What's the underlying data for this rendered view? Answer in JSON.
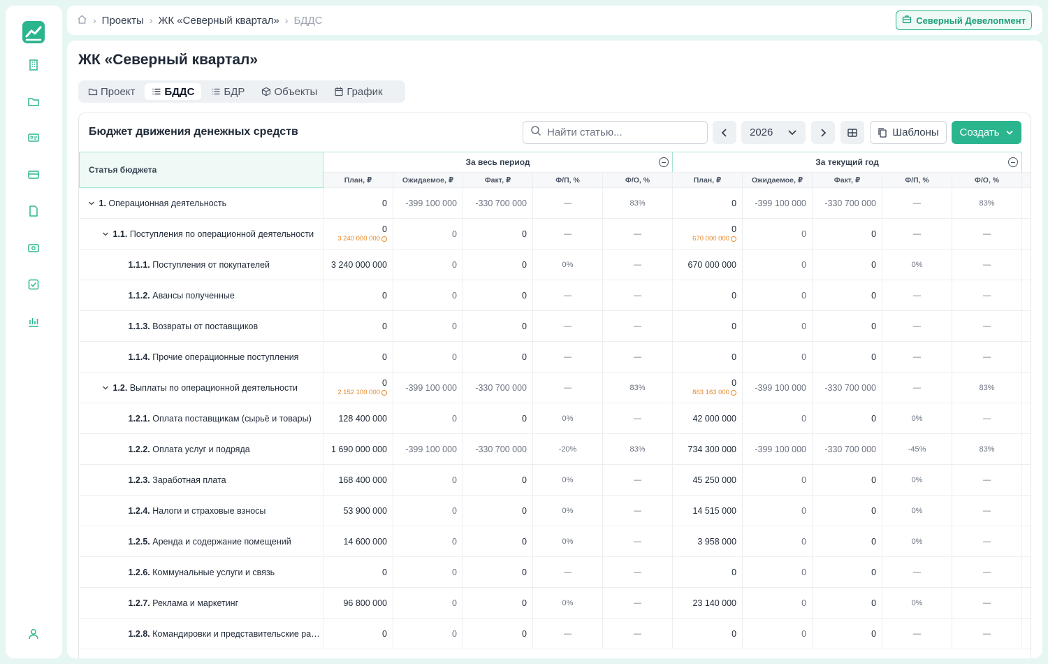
{
  "header": {
    "breadcrumbs": [
      "Проекты",
      "ЖК «Северный квартал»",
      "БДДС"
    ],
    "organization": "Северный Девелопмент"
  },
  "page": {
    "title": "ЖК «Северный квартал»",
    "tabs": [
      {
        "label": "Проект",
        "icon": "folder-icon"
      },
      {
        "label": "БДДС",
        "icon": "list-icon",
        "active": true
      },
      {
        "label": "БДР",
        "icon": "list-icon"
      },
      {
        "label": "Объекты",
        "icon": "cube-icon"
      },
      {
        "label": "График",
        "icon": "calendar-icon"
      }
    ]
  },
  "card": {
    "title": "Бюджет движения денежных средств",
    "search_placeholder": "Найти статью...",
    "year": "2026",
    "templates_label": "Шаблоны",
    "create_label": "Создать"
  },
  "table": {
    "article_header": "Статья бюджета",
    "groups": [
      "За весь период",
      "За текущий год"
    ],
    "subheaders": [
      "План, ₽",
      "Ожидаемое, ₽",
      "Факт, ₽",
      "Ф/П, %",
      "Ф/О, %"
    ],
    "rows": [
      {
        "level": 0,
        "code": "1.",
        "name": "Операционная деятельность",
        "expandable": true,
        "cells": [
          {
            "v": "0"
          },
          {
            "v": "-399 100 000",
            "m": true
          },
          {
            "v": "-330 700 000",
            "m": true
          },
          {
            "v": "—"
          },
          {
            "v": "83%"
          },
          {
            "v": "0"
          },
          {
            "v": "-399 100 000",
            "m": true
          },
          {
            "v": "-330 700 000",
            "m": true
          },
          {
            "v": "—"
          },
          {
            "v": "83%"
          }
        ]
      },
      {
        "level": 1,
        "code": "1.1.",
        "name": "Поступления по операционной деятельности",
        "expandable": true,
        "cells": [
          {
            "v": "0",
            "w": "3 240 000 000"
          },
          {
            "v": "0",
            "m": true
          },
          {
            "v": "0"
          },
          {
            "v": "—"
          },
          {
            "v": "—"
          },
          {
            "v": "0",
            "w": "670 000 000"
          },
          {
            "v": "0",
            "m": true
          },
          {
            "v": "0"
          },
          {
            "v": "—"
          },
          {
            "v": "—"
          }
        ]
      },
      {
        "level": 2,
        "code": "1.1.1.",
        "name": "Поступления от покупателей",
        "cells": [
          {
            "v": "3 240 000 000"
          },
          {
            "v": "0",
            "m": true
          },
          {
            "v": "0"
          },
          {
            "v": "0%"
          },
          {
            "v": "—"
          },
          {
            "v": "670 000 000"
          },
          {
            "v": "0",
            "m": true
          },
          {
            "v": "0"
          },
          {
            "v": "0%"
          },
          {
            "v": "—"
          }
        ]
      },
      {
        "level": 2,
        "code": "1.1.2.",
        "name": "Авансы полученные",
        "cells": [
          {
            "v": "0"
          },
          {
            "v": "0",
            "m": true
          },
          {
            "v": "0"
          },
          {
            "v": "—"
          },
          {
            "v": "—"
          },
          {
            "v": "0"
          },
          {
            "v": "0",
            "m": true
          },
          {
            "v": "0"
          },
          {
            "v": "—"
          },
          {
            "v": "—"
          }
        ]
      },
      {
        "level": 2,
        "code": "1.1.3.",
        "name": "Возвраты от поставщиков",
        "cells": [
          {
            "v": "0"
          },
          {
            "v": "0",
            "m": true
          },
          {
            "v": "0"
          },
          {
            "v": "—"
          },
          {
            "v": "—"
          },
          {
            "v": "0"
          },
          {
            "v": "0",
            "m": true
          },
          {
            "v": "0"
          },
          {
            "v": "—"
          },
          {
            "v": "—"
          }
        ]
      },
      {
        "level": 2,
        "code": "1.1.4.",
        "name": "Прочие операционные поступления",
        "cells": [
          {
            "v": "0"
          },
          {
            "v": "0",
            "m": true
          },
          {
            "v": "0"
          },
          {
            "v": "—"
          },
          {
            "v": "—"
          },
          {
            "v": "0"
          },
          {
            "v": "0",
            "m": true
          },
          {
            "v": "0"
          },
          {
            "v": "—"
          },
          {
            "v": "—"
          }
        ]
      },
      {
        "level": 1,
        "code": "1.2.",
        "name": "Выплаты по операционной деятельности",
        "expandable": true,
        "cells": [
          {
            "v": "0",
            "w": "2 152 100 000"
          },
          {
            "v": "-399 100 000",
            "m": true
          },
          {
            "v": "-330 700 000",
            "m": true
          },
          {
            "v": "—"
          },
          {
            "v": "83%"
          },
          {
            "v": "0",
            "w": "863 163 000"
          },
          {
            "v": "-399 100 000",
            "m": true
          },
          {
            "v": "-330 700 000",
            "m": true
          },
          {
            "v": "—"
          },
          {
            "v": "83%"
          }
        ]
      },
      {
        "level": 2,
        "code": "1.2.1.",
        "name": "Оплата поставщикам (сырьё и товары)",
        "cells": [
          {
            "v": "128 400 000"
          },
          {
            "v": "0",
            "m": true
          },
          {
            "v": "0"
          },
          {
            "v": "0%"
          },
          {
            "v": "—"
          },
          {
            "v": "42 000 000"
          },
          {
            "v": "0",
            "m": true
          },
          {
            "v": "0"
          },
          {
            "v": "0%"
          },
          {
            "v": "—"
          }
        ]
      },
      {
        "level": 2,
        "code": "1.2.2.",
        "name": "Оплата услуг и подряда",
        "cells": [
          {
            "v": "1 690 000 000"
          },
          {
            "v": "-399 100 000",
            "m": true
          },
          {
            "v": "-330 700 000",
            "m": true
          },
          {
            "v": "-20%"
          },
          {
            "v": "83%"
          },
          {
            "v": "734 300 000"
          },
          {
            "v": "-399 100 000",
            "m": true
          },
          {
            "v": "-330 700 000",
            "m": true
          },
          {
            "v": "-45%"
          },
          {
            "v": "83%"
          }
        ]
      },
      {
        "level": 2,
        "code": "1.2.3.",
        "name": "Заработная плата",
        "cells": [
          {
            "v": "168 400 000"
          },
          {
            "v": "0",
            "m": true
          },
          {
            "v": "0"
          },
          {
            "v": "0%"
          },
          {
            "v": "—"
          },
          {
            "v": "45 250 000"
          },
          {
            "v": "0",
            "m": true
          },
          {
            "v": "0"
          },
          {
            "v": "0%"
          },
          {
            "v": "—"
          }
        ]
      },
      {
        "level": 2,
        "code": "1.2.4.",
        "name": "Налоги и страховые взносы",
        "cells": [
          {
            "v": "53 900 000"
          },
          {
            "v": "0",
            "m": true
          },
          {
            "v": "0"
          },
          {
            "v": "0%"
          },
          {
            "v": "—"
          },
          {
            "v": "14 515 000"
          },
          {
            "v": "0",
            "m": true
          },
          {
            "v": "0"
          },
          {
            "v": "0%"
          },
          {
            "v": "—"
          }
        ]
      },
      {
        "level": 2,
        "code": "1.2.5.",
        "name": "Аренда и содержание помещений",
        "cells": [
          {
            "v": "14 600 000"
          },
          {
            "v": "0",
            "m": true
          },
          {
            "v": "0"
          },
          {
            "v": "0%"
          },
          {
            "v": "—"
          },
          {
            "v": "3 958 000"
          },
          {
            "v": "0",
            "m": true
          },
          {
            "v": "0"
          },
          {
            "v": "0%"
          },
          {
            "v": "—"
          }
        ]
      },
      {
        "level": 2,
        "code": "1.2.6.",
        "name": "Коммунальные услуги и связь",
        "cells": [
          {
            "v": "0"
          },
          {
            "v": "0",
            "m": true
          },
          {
            "v": "0"
          },
          {
            "v": "—"
          },
          {
            "v": "—"
          },
          {
            "v": "0"
          },
          {
            "v": "0",
            "m": true
          },
          {
            "v": "0"
          },
          {
            "v": "—"
          },
          {
            "v": "—"
          }
        ]
      },
      {
        "level": 2,
        "code": "1.2.7.",
        "name": "Реклама и маркетинг",
        "cells": [
          {
            "v": "96 800 000"
          },
          {
            "v": "0",
            "m": true
          },
          {
            "v": "0"
          },
          {
            "v": "0%"
          },
          {
            "v": "—"
          },
          {
            "v": "23 140 000"
          },
          {
            "v": "0",
            "m": true
          },
          {
            "v": "0"
          },
          {
            "v": "0%"
          },
          {
            "v": "—"
          }
        ]
      },
      {
        "level": 2,
        "code": "1.2.8.",
        "name": "Командировки и представительские расходы",
        "cells": [
          {
            "v": "0"
          },
          {
            "v": "0",
            "m": true
          },
          {
            "v": "0"
          },
          {
            "v": "—"
          },
          {
            "v": "—"
          },
          {
            "v": "0"
          },
          {
            "v": "0",
            "m": true
          },
          {
            "v": "0"
          },
          {
            "v": "—"
          },
          {
            "v": "—"
          }
        ]
      }
    ]
  },
  "sidebar": {
    "items": [
      "building-icon",
      "folder-icon",
      "id-card-icon",
      "credit-card-icon",
      "file-icon",
      "banknote-icon",
      "checkbox-icon",
      "bar-chart-icon"
    ],
    "bottom": "user-icon"
  },
  "colors": {
    "accent": "#2bb58f",
    "warning": "#e98a2a"
  }
}
